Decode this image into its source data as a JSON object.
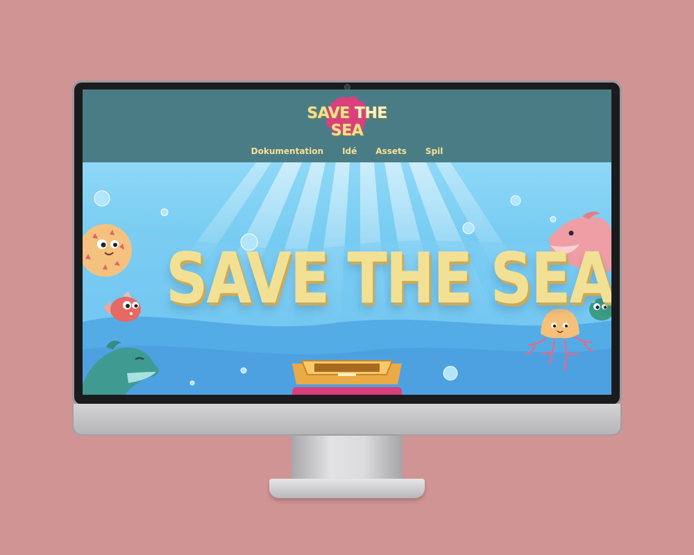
{
  "site": {
    "logo_text_part1": "SAVE",
    "logo_text_part2": "THE",
    "logo_text_part3": "SEA"
  },
  "nav": {
    "items": [
      {
        "label": "Dokumentation"
      },
      {
        "label": "Idé"
      },
      {
        "label": "Assets"
      },
      {
        "label": "Spil"
      }
    ]
  },
  "hero": {
    "title": "SAVE THE SEA"
  },
  "colors": {
    "page_background": "#d19494",
    "header_background": "#4a7c86",
    "nav_text": "#f5e191",
    "logo_blob": "#d9407d",
    "sea": "#6fc4ee",
    "title_text": "#f2e194"
  },
  "icons": {
    "characters": [
      "pufferfish-icon",
      "red-fish-icon",
      "dolphin-icon",
      "pink-dolphin-icon",
      "jellyfish-icon",
      "green-fish-icon",
      "treasure-chest-icon"
    ]
  }
}
